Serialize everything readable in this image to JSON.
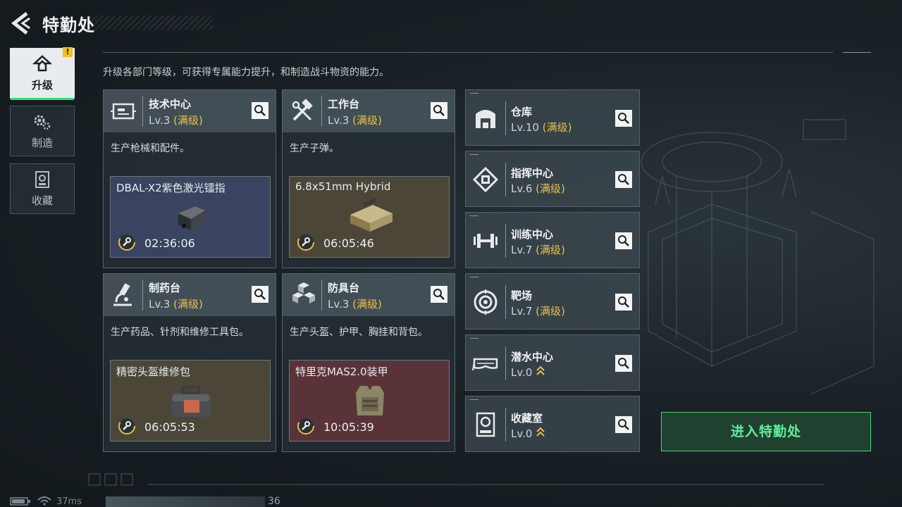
{
  "header": {
    "title": "特勤处"
  },
  "nav": [
    {
      "label": "升级",
      "icon": "upgrade-icon",
      "active": true,
      "warning": "!"
    },
    {
      "label": "制造",
      "icon": "gears-icon",
      "active": false
    },
    {
      "label": "收藏",
      "icon": "collection-icon",
      "active": false
    }
  ],
  "subtitle": "升级各部门等级，可获得专属能力提升，和制造战斗物资的能力。",
  "workshops": [
    {
      "name": "技术中心",
      "level": "Lv.3",
      "max": "(满级)",
      "icon": "tech-center-icon",
      "desc": "生产枪械和配件。",
      "product": {
        "name": "DBAL-X2紫色激光镭指",
        "timer": "02:36:06",
        "bg": "#3a4360"
      }
    },
    {
      "name": "工作台",
      "level": "Lv.3",
      "max": "(满级)",
      "icon": "hammer-wrench-icon",
      "desc": "生产子弹。",
      "product": {
        "name": "6.8x51mm Hybrid",
        "timer": "06:05:46",
        "bg": "#4c4639"
      }
    },
    {
      "name": "制药台",
      "level": "Lv.3",
      "max": "(满级)",
      "icon": "microscope-icon",
      "desc": "生产药品、针剂和维修工具包。",
      "product": {
        "name": "精密头盔维修包",
        "timer": "06:05:53",
        "bg": "#4c4639"
      }
    },
    {
      "name": "防具台",
      "level": "Lv.3",
      "max": "(满级)",
      "icon": "armor-blocks-icon",
      "desc": "生产头盔、护甲、胸挂和背包。",
      "product": {
        "name": "特里克MAS2.0装甲",
        "timer": "10:05:39",
        "bg": "#5a3338"
      }
    }
  ],
  "facilities": [
    {
      "name": "仓库",
      "level": "Lv.10",
      "max": "(满级)",
      "upgradable": false,
      "icon": "warehouse-icon"
    },
    {
      "name": "指挥中心",
      "level": "Lv.6",
      "max": "(满级)",
      "upgradable": false,
      "icon": "chip-icon"
    },
    {
      "name": "训练中心",
      "level": "Lv.7",
      "max": "(满级)",
      "upgradable": false,
      "icon": "dumbbell-icon"
    },
    {
      "name": "靶场",
      "level": "Lv.7",
      "max": "(满级)",
      "upgradable": false,
      "icon": "target-icon"
    },
    {
      "name": "潜水中心",
      "level": "Lv.0",
      "max": "",
      "upgradable": true,
      "icon": "dive-mask-icon"
    },
    {
      "name": "收藏室",
      "level": "Lv.0",
      "max": "",
      "upgradable": true,
      "icon": "collection-room-icon"
    }
  ],
  "enter_button": "进入特勤处",
  "status": {
    "ping": "37ms",
    "number": "36"
  },
  "colors": {
    "accent_green": "#3fd47a",
    "max_level": "#e8c04a",
    "warning": "#f0c020"
  }
}
